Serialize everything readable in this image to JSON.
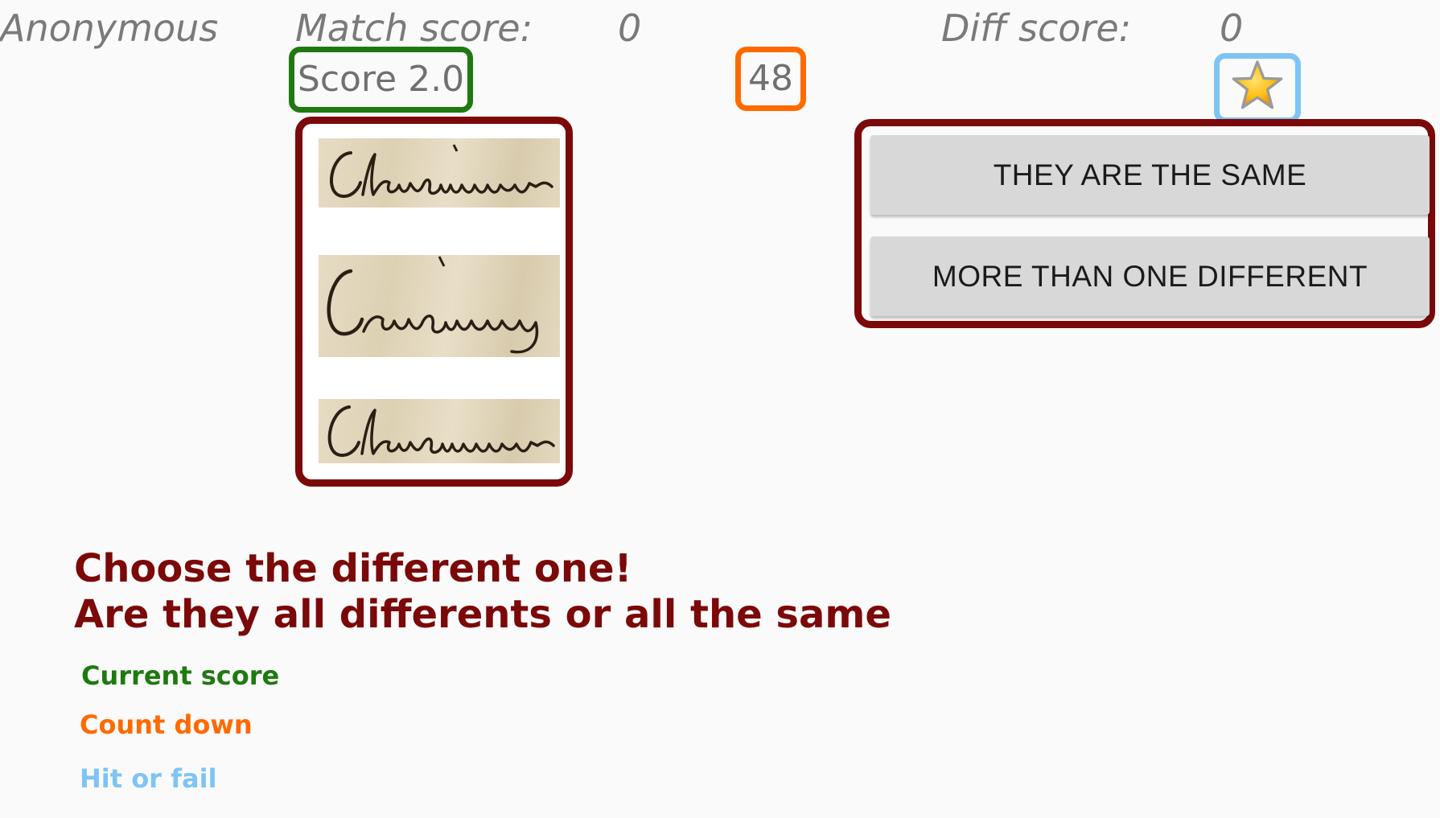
{
  "header": {
    "username": "Anonymous",
    "match_label": "Match score:",
    "match_value": "0",
    "diff_label": "Diff score:",
    "diff_value": "0"
  },
  "status": {
    "score_text": "Score 2.0",
    "countdown_text": "48",
    "hit_icon": "star-icon"
  },
  "signatures": [
    {
      "text": "Claramunt"
    },
    {
      "text": "Caramany"
    },
    {
      "text": "Claramunt"
    }
  ],
  "buttons": {
    "same_label": "THEY ARE THE SAME",
    "different_label": "MORE THAN ONE DIFFERENT"
  },
  "instructions": {
    "line1": "Choose the different one!",
    "line2": "Are they all differents or all the same"
  },
  "legend": {
    "score": {
      "label": "Current score",
      "color": "#1e7a10"
    },
    "countdown": {
      "label": "Count down",
      "color": "#ff6a00"
    },
    "hit": {
      "label": "Hit or fail",
      "color": "#7ec4f5"
    }
  },
  "colors": {
    "score_border": "#1e7a10",
    "countdown_border": "#ff6a00",
    "hit_border": "#7ec4f5",
    "panel_border": "#7b0909",
    "star_fill": "#ffc21a"
  }
}
